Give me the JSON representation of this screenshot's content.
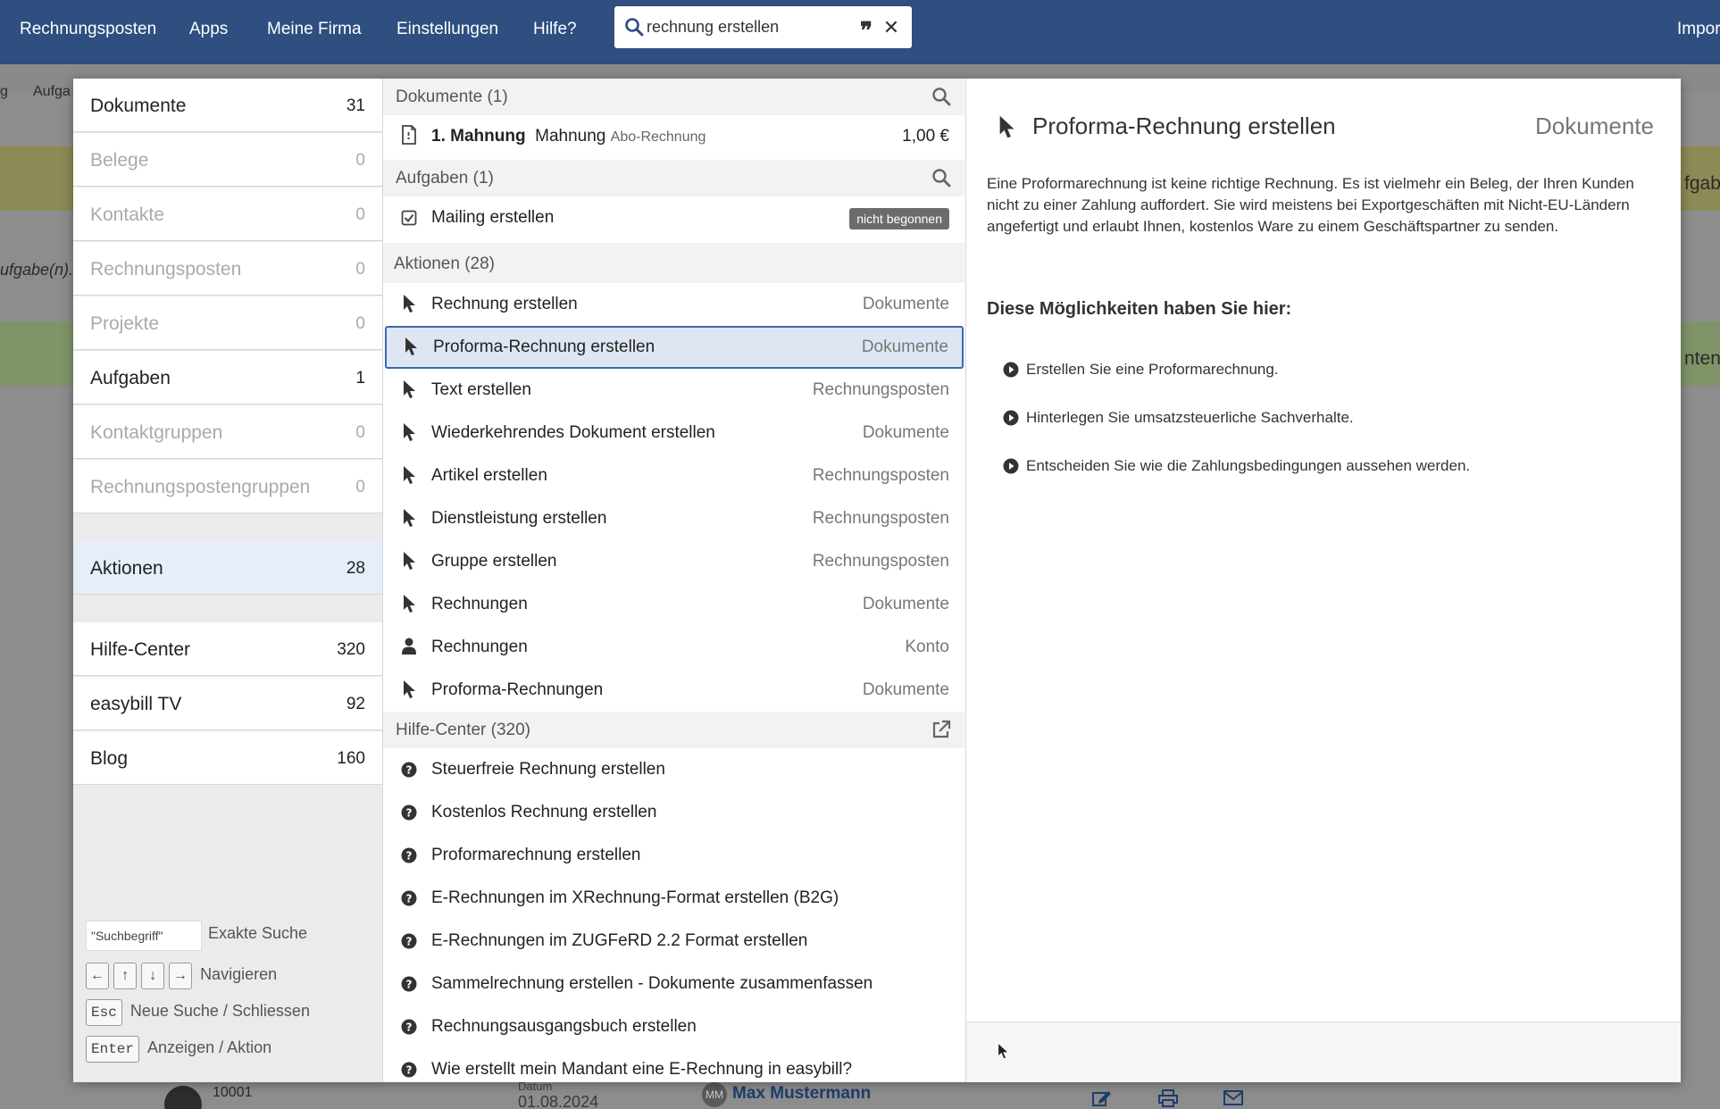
{
  "nav": {
    "items": [
      "Rechnungsposten",
      "Apps",
      "Meine Firma",
      "Einstellungen",
      "Hilfe?"
    ],
    "right_item": "Impor",
    "search_value": "rechnung erstellen",
    "quote_glyph": "❞",
    "close_glyph": "✕"
  },
  "background": {
    "tab_left": "g",
    "tab_aufga": "Aufga",
    "aufgabe_text": "ufgabe(n).",
    "right_text_1": "fgabe",
    "right_text_2": "nten",
    "customer_number": "10001",
    "datum_label": "Datum",
    "date": "01.08.2024",
    "avatar_initials": "MM",
    "user_name": "Max Mustermann"
  },
  "categories": [
    {
      "label": "Dokumente",
      "count": "31",
      "state": "normal"
    },
    {
      "label": "Belege",
      "count": "0",
      "state": "disabled"
    },
    {
      "label": "Kontakte",
      "count": "0",
      "state": "disabled"
    },
    {
      "label": "Rechnungsposten",
      "count": "0",
      "state": "disabled"
    },
    {
      "label": "Projekte",
      "count": "0",
      "state": "disabled"
    },
    {
      "label": "Aufgaben",
      "count": "1",
      "state": "normal"
    },
    {
      "label": "Kontaktgruppen",
      "count": "0",
      "state": "disabled"
    },
    {
      "label": "Rechnungspostengruppen",
      "count": "0",
      "state": "disabled"
    },
    {
      "label": "Aktionen",
      "count": "28",
      "state": "active"
    },
    {
      "label": "Hilfe-Center",
      "count": "320",
      "state": "normal"
    },
    {
      "label": "easybill TV",
      "count": "92",
      "state": "normal"
    },
    {
      "label": "Blog",
      "count": "160",
      "state": "normal"
    }
  ],
  "hints": {
    "exact_input": "\"Suchbegriff\"",
    "exact_label": "Exakte Suche",
    "nav_keys": [
      "←",
      "↑",
      "↓",
      "→"
    ],
    "nav_label": "Navigieren",
    "esc_key": "Esc",
    "esc_label": "Neue Suche / Schliessen",
    "enter_key": "Enter",
    "enter_label": "Anzeigen / Aktion"
  },
  "results": {
    "dokumente": {
      "title": "Dokumente (1)",
      "item": {
        "bold": "1. Mahnung",
        "name": "Mahnung",
        "type": "Abo-Rechnung",
        "amount": "1,00 €"
      }
    },
    "aufgaben": {
      "title": "Aufgaben (1)",
      "item": {
        "label": "Mailing erstellen",
        "badge": "nicht begonnen"
      }
    },
    "aktionen": {
      "title": "Aktionen (28)",
      "items": [
        {
          "label": "Rechnung erstellen",
          "cat": "Dokumente",
          "icon": "pointer-icon"
        },
        {
          "label": "Proforma-Rechnung erstellen",
          "cat": "Dokumente",
          "icon": "pointer-icon",
          "selected": true
        },
        {
          "label": "Text erstellen",
          "cat": "Rechnungsposten",
          "icon": "pointer-icon"
        },
        {
          "label": "Wiederkehrendes Dokument erstellen",
          "cat": "Dokumente",
          "icon": "pointer-icon"
        },
        {
          "label": "Artikel erstellen",
          "cat": "Rechnungsposten",
          "icon": "pointer-icon"
        },
        {
          "label": "Dienstleistung erstellen",
          "cat": "Rechnungsposten",
          "icon": "pointer-icon"
        },
        {
          "label": "Gruppe erstellen",
          "cat": "Rechnungsposten",
          "icon": "pointer-icon"
        },
        {
          "label": "Rechnungen",
          "cat": "Dokumente",
          "icon": "pointer-icon"
        },
        {
          "label": "Rechnungen",
          "cat": "Konto",
          "icon": "user-icon"
        },
        {
          "label": "Proforma-Rechnungen",
          "cat": "Dokumente",
          "icon": "pointer-icon"
        }
      ]
    },
    "hilfe": {
      "title": "Hilfe-Center (320)",
      "items": [
        "Steuerfreie Rechnung erstellen",
        "Kostenlos Rechnung erstellen",
        "Proformarechnung erstellen",
        "E-Rechnungen im XRechnung-Format erstellen (B2G)",
        "E-Rechnungen im ZUGFeRD 2.2 Format erstellen",
        "Sammelrechnung erstellen - Dokumente zusammenfassen",
        "Rechnungsausgangsbuch erstellen",
        "Wie erstellt mein Mandant eine E-Rechnung in easybill?"
      ]
    }
  },
  "detail": {
    "title": "Proforma-Rechnung erstellen",
    "category": "Dokumente",
    "description": "Eine Proformarechnung ist keine richtige Rechnung. Es ist vielmehr ein Beleg, der Ihren Kunden nicht zu einer Zahlung auffordert. Sie wird meistens bei Exportgeschäften mit Nicht-EU-Ländern angefertigt und erlaubt Ihnen, kostenlos Ware zu einem Geschäftspartner zu senden.",
    "subtitle": "Diese Möglichkeiten haben Sie hier:",
    "bullets": [
      "Erstellen Sie eine Proformarechnung.",
      "Hinterlegen Sie umsatzsteuerliche Sachverhalte.",
      "Entscheiden Sie wie die Zahlungsbedingungen aussehen werden."
    ]
  },
  "colors": {
    "nav_bg": "#2e4f80",
    "selected_border": "#3b67b3",
    "selected_bg": "#dfe6f3",
    "active_category_bg": "#e5eefa",
    "badge_bg": "#6c6c6c"
  }
}
